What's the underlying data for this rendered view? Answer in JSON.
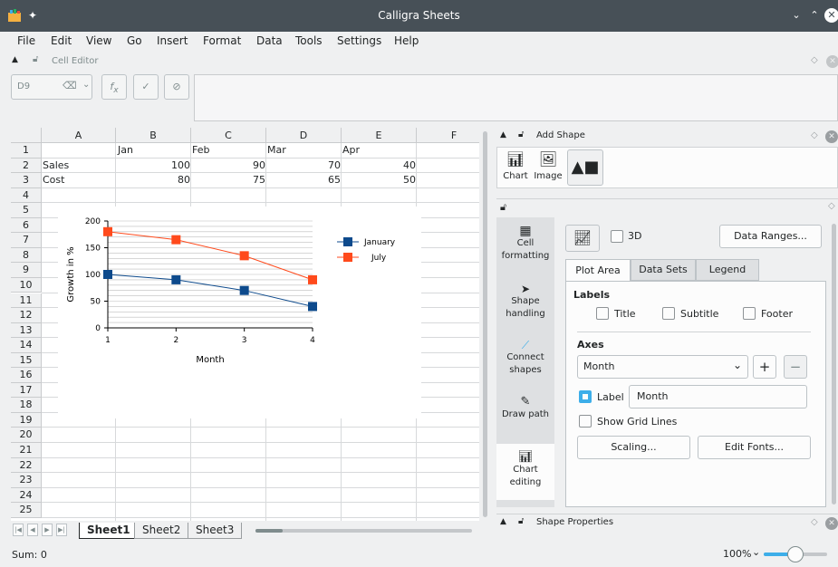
{
  "window": {
    "title": "Calligra Sheets"
  },
  "menu": [
    "File",
    "Edit",
    "View",
    "Go",
    "Insert",
    "Format",
    "Data",
    "Tools",
    "Settings",
    "Help"
  ],
  "cell_editor": {
    "title": "Cell Editor",
    "cell_ref": "D9"
  },
  "columns": [
    "A",
    "B",
    "C",
    "D",
    "E",
    "F"
  ],
  "rows": [
    "1",
    "2",
    "3",
    "4",
    "5",
    "6",
    "7",
    "8",
    "9",
    "10",
    "11",
    "12",
    "13",
    "14",
    "15",
    "16",
    "17",
    "18",
    "19",
    "20",
    "21",
    "22",
    "23",
    "24",
    "25"
  ],
  "cells": {
    "b1": "Jan",
    "c1": "Feb",
    "d1": "Mar",
    "e1": "Apr",
    "a2": "Sales",
    "b2": "100",
    "c2": "90",
    "d2": "70",
    "e2": "40",
    "a3": "Cost",
    "b3": "80",
    "c3": "75",
    "d3": "65",
    "e3": "50"
  },
  "chart_data": {
    "type": "line",
    "x": [
      1,
      2,
      3,
      4
    ],
    "xlabel": "Month",
    "ylabel": "Growth in %",
    "ylim": [
      0,
      200
    ],
    "yticks": [
      0,
      50,
      100,
      150,
      200
    ],
    "grid": true,
    "legend_position": "right",
    "series": [
      {
        "name": "January",
        "values": [
          100,
          90,
          70,
          40
        ],
        "color": "#0d4a8c"
      },
      {
        "name": "July",
        "values": [
          180,
          165,
          135,
          90
        ],
        "color": "#ff4a1c"
      }
    ]
  },
  "sheets": {
    "tabs": [
      "Sheet1",
      "Sheet2",
      "Sheet3"
    ],
    "active": "Sheet1"
  },
  "status": {
    "sum": "Sum: 0",
    "zoom": "100%",
    "zoom_level": 0.5
  },
  "add_shape": {
    "title": "Add Shape",
    "items": [
      "Chart",
      "Image"
    ]
  },
  "tools": {
    "items": [
      "Cell formatting",
      "Shape handling",
      "Connect shapes",
      "Draw path",
      "Chart editing"
    ]
  },
  "chart_editor": {
    "three_d": "3D",
    "data_ranges": "Data Ranges...",
    "tabs": [
      "Plot Area",
      "Data Sets",
      "Legend"
    ],
    "labels_heading": "Labels",
    "title_label": "Title",
    "subtitle_label": "Subtitle",
    "footer_label": "Footer",
    "axes_heading": "Axes",
    "axis_select": "Month",
    "label_check": "Label",
    "label_value": "Month",
    "grid_lines": "Show Grid Lines",
    "scaling": "Scaling...",
    "edit_fonts": "Edit Fonts..."
  },
  "shape_properties": {
    "title": "Shape Properties"
  },
  "colors": {
    "accent": "#3daee9",
    "titlebar": "#475057"
  }
}
